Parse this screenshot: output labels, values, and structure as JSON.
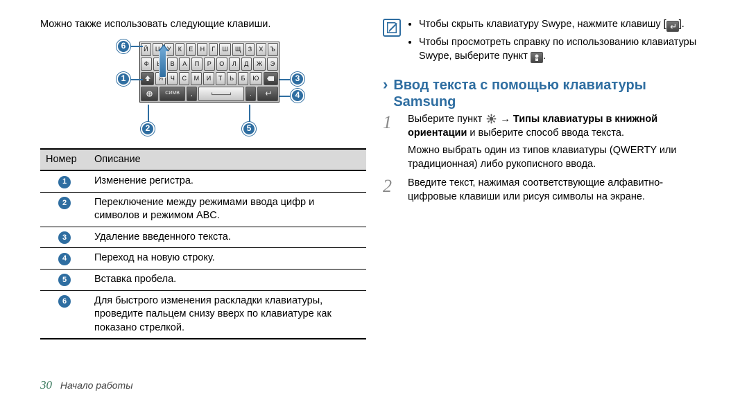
{
  "left": {
    "intro": "Можно также использовать следующие клавиши.",
    "keyboard": {
      "rows": [
        [
          "Й",
          "Ц",
          "У",
          "К",
          "Е",
          "Н",
          "Г",
          "Ш",
          "Щ",
          "З",
          "Х",
          "Ъ"
        ],
        [
          "Ф",
          "Ы",
          "В",
          "А",
          "П",
          "Р",
          "О",
          "Л",
          "Д",
          "Ж",
          "Э"
        ],
        [
          "Я",
          "Ч",
          "С",
          "М",
          "И",
          "Т",
          "Ь",
          "Б",
          "Ю"
        ]
      ]
    },
    "callouts": {
      "c1": "1",
      "c2": "2",
      "c3": "3",
      "c4": "4",
      "c5": "5",
      "c6": "6"
    },
    "table": {
      "head": {
        "num": "Номер",
        "desc": "Описание"
      },
      "rows": [
        {
          "n": "1",
          "d": "Изменение регистра."
        },
        {
          "n": "2",
          "d": "Переключение между режимами ввода цифр и символов и режимом ABC."
        },
        {
          "n": "3",
          "d": "Удаление введенного текста."
        },
        {
          "n": "4",
          "d": "Переход на новую строку."
        },
        {
          "n": "5",
          "d": "Вставка пробела."
        },
        {
          "n": "6",
          "d": "Для быстрого изменения раскладки клавиатуры, проведите пальцем снизу вверх по клавиатуре как показано стрелкой."
        }
      ]
    }
  },
  "right": {
    "tips": {
      "items": [
        {
          "pre": "Чтобы скрыть клавиатуру Swype, нажмите клавишу ",
          "iconLabel": "[",
          "post": "]."
        },
        {
          "pre": "Чтобы просмотреть справку по использованию клавиатуры Swype, выберите пункт ",
          "iconLabel": "",
          "post": "."
        }
      ]
    },
    "section": "Ввод текста с помощью клавиатуры Samsung",
    "steps": [
      {
        "n": "1",
        "pre": "Выберите пункт ",
        "strong": "→ Типы клавиатуры в книжной ориентации",
        "post": " и выберите способ ввода текста.",
        "sub": "Можно выбрать один из типов клавиатуры (QWERTY или традиционная) либо рукописного ввода."
      },
      {
        "n": "2",
        "pre": "Введите текст, нажимая соответствующие алфавитно-цифровые клавиши или рисуя символы на экране.",
        "strong": "",
        "post": "",
        "sub": ""
      }
    ]
  },
  "footer": {
    "page": "30",
    "label": "Начало работы"
  }
}
